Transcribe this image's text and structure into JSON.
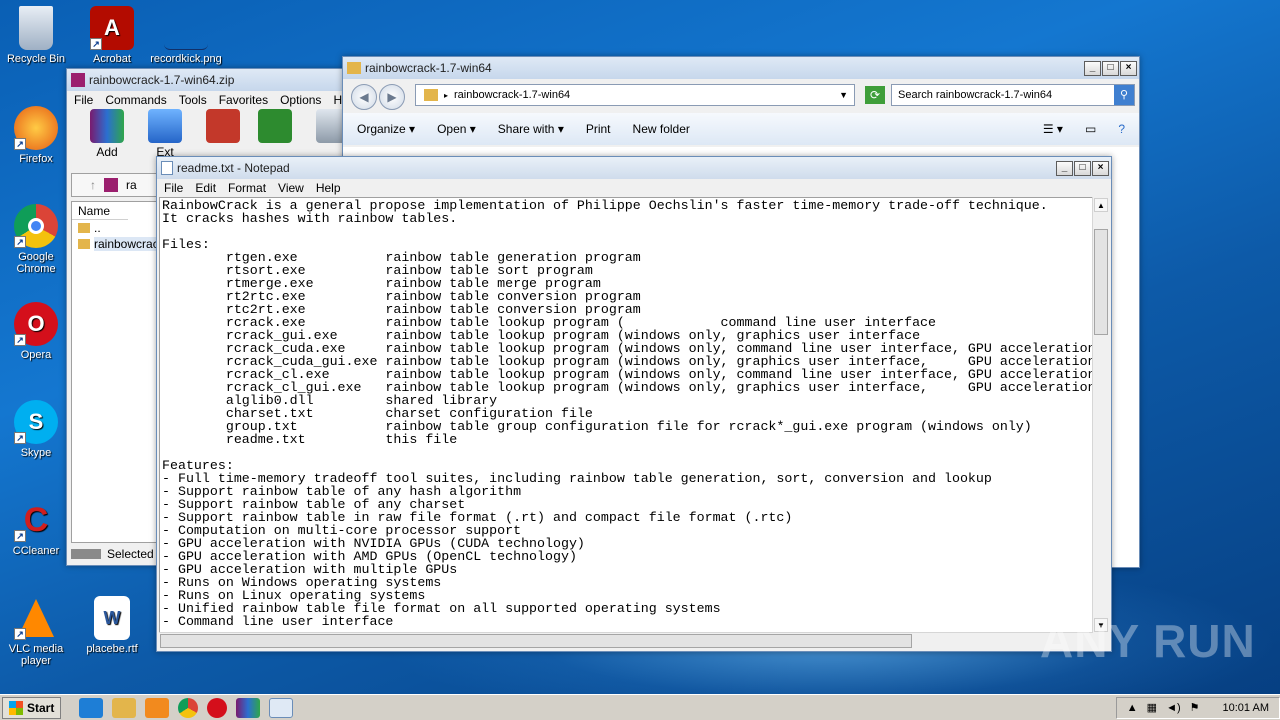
{
  "desktop": {
    "icons": [
      {
        "label": "Recycle Bin"
      },
      {
        "label": "Acrobat"
      },
      {
        "label": "recordkick.png"
      },
      {
        "label": "Firefox"
      },
      {
        "label": "Google Chrome"
      },
      {
        "label": "Opera"
      },
      {
        "label": "Skype"
      },
      {
        "label": "CCleaner"
      },
      {
        "label": "VLC media player"
      },
      {
        "label": "placebe.rtf"
      }
    ]
  },
  "winrar": {
    "title": "rainbowcrack-1.7-win64.zip",
    "menu": [
      "File",
      "Commands",
      "Tools",
      "Favorites",
      "Options",
      "Help"
    ],
    "toolbar": {
      "add_label": "Add",
      "extract_label": "Ext"
    },
    "path_fragment": "ra",
    "column_name": "Name",
    "rows": [
      "..",
      "rainbowcrack"
    ],
    "status": "Selected"
  },
  "explorer": {
    "title": "rainbowcrack-1.7-win64",
    "address": "rainbowcrack-1.7-win64",
    "search_placeholder": "Search rainbowcrack-1.7-win64",
    "commands": {
      "organize": "Organize",
      "open": "Open",
      "share": "Share with",
      "print": "Print",
      "new_folder": "New folder"
    }
  },
  "notepad": {
    "title": "readme.txt - Notepad",
    "menu": [
      "File",
      "Edit",
      "Format",
      "View",
      "Help"
    ],
    "text_lines": [
      "RainbowCrack is a general propose implementation of Philippe Oechslin's faster time-memory trade-off technique.",
      "It cracks hashes with rainbow tables.",
      "",
      "Files:",
      "        rtgen.exe           rainbow table generation program",
      "        rtsort.exe          rainbow table sort program",
      "        rtmerge.exe         rainbow table merge program",
      "        rt2rtc.exe          rainbow table conversion program",
      "        rtc2rt.exe          rainbow table conversion program",
      "        rcrack.exe          rainbow table lookup program (            command line user interface",
      "        rcrack_gui.exe      rainbow table lookup program (windows only, graphics user interface",
      "        rcrack_cuda.exe     rainbow table lookup program (windows only, command line user interface, GPU acceleration",
      "        rcrack_cuda_gui.exe rainbow table lookup program (windows only, graphics user interface,     GPU acceleration",
      "        rcrack_cl.exe       rainbow table lookup program (windows only, command line user interface, GPU acceleration",
      "        rcrack_cl_gui.exe   rainbow table lookup program (windows only, graphics user interface,     GPU acceleration",
      "        alglib0.dll         shared library",
      "        charset.txt         charset configuration file",
      "        group.txt           rainbow table group configuration file for rcrack*_gui.exe program (windows only)",
      "        readme.txt          this file",
      "",
      "Features:",
      "- Full time-memory tradeoff tool suites, including rainbow table generation, sort, conversion and lookup",
      "- Support rainbow table of any hash algorithm",
      "- Support rainbow table of any charset",
      "- Support rainbow table in raw file format (.rt) and compact file format (.rtc)",
      "- Computation on multi-core processor support",
      "- GPU acceleration with NVIDIA GPUs (CUDA technology)",
      "- GPU acceleration with AMD GPUs (OpenCL technology)",
      "- GPU acceleration with multiple GPUs",
      "- Runs on Windows operating systems",
      "- Runs on Linux operating systems",
      "- Unified rainbow table file format on all supported operating systems",
      "- Command line user interface"
    ]
  },
  "taskbar": {
    "start_label": "Start",
    "clock": "10:01 AM"
  },
  "watermark": "ANY RUN"
}
